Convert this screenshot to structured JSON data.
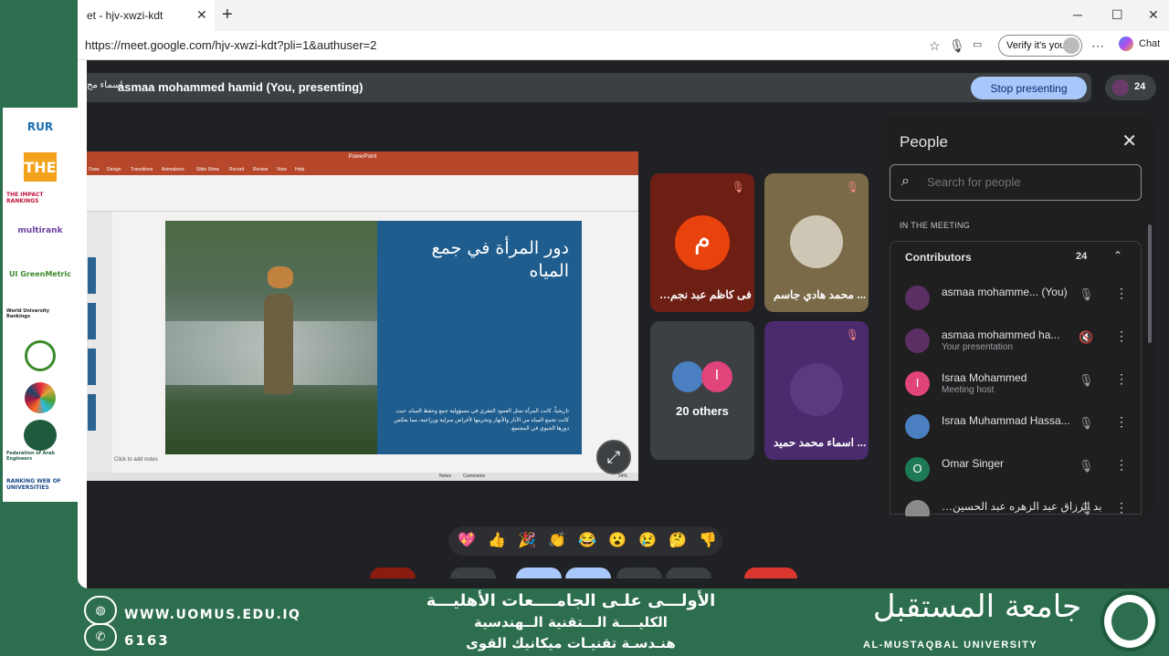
{
  "browser": {
    "tab_title": "et - hjv-xwzi-kdt",
    "tab_close": "✕",
    "new_tab": "+",
    "url": "https://meet.google.com/hjv-xwzi-kdt?pli=1&authuser=2",
    "verify_label": "Verify it's you",
    "chat_label": "Chat",
    "window_controls": {
      "minimize": "─",
      "maximize": "☐",
      "close": "✕"
    }
  },
  "meet": {
    "presenting_cut": "اسماء مح",
    "presenting_label": "asmaa mohammed hamid (You, presenting)",
    "stop_label": "Stop presenting",
    "participant_count": "24",
    "expand_icon": "⤢"
  },
  "slide": {
    "title": "دور المرأة في جمع المياه",
    "body": "تاريخياً، كانت المرأة تمثل العمود الفقري في مسؤولية جمع وحفظ المياه. حيث كانت تجمع المياه من الآبار والأنهار وتخزينها لأغراض منزلية وزراعية، مما يعكس دورها الحيوي في المجتمع.",
    "notes_placeholder": "Click to add notes",
    "ribbon_tabs": [
      "Draw",
      "Design",
      "Transitions",
      "Animations",
      "Slide Show",
      "Record",
      "Review",
      "View",
      "Help"
    ],
    "status_notes": "Notes",
    "status_comments": "Comments",
    "status_zoom": "54%"
  },
  "tiles": [
    {
      "name": "…فى كاظم عبد نجم",
      "initial": "م",
      "color": "#e8430c"
    },
    {
      "name": "محمد هادي جاسم ...",
      "color": "#7a6a48"
    },
    {
      "name": "20 others",
      "initial": "I",
      "color": "#e0447a"
    },
    {
      "name": "اسماء محمد حميد ...",
      "color": "#4b2a6e"
    }
  ],
  "people": {
    "title": "People",
    "search_placeholder": "Search for people",
    "section_label": "IN THE MEETING",
    "group_label": "Contributors",
    "group_count": "24",
    "rows": [
      {
        "name": "asmaa mohamme...  (You)",
        "sub": "",
        "initial": "",
        "color": "#5b2f64"
      },
      {
        "name": "asmaa mohammed ha...",
        "sub": "Your presentation",
        "initial": "",
        "color": "#5b2f64"
      },
      {
        "name": "Israa Mohammed",
        "sub": "Meeting host",
        "initial": "I",
        "color": "#e0447a"
      },
      {
        "name": "Israa Muhammad Hassa...",
        "sub": "",
        "initial": "",
        "color": "#4a7fc1"
      },
      {
        "name": "Omar Singer",
        "sub": "",
        "initial": "O",
        "color": "#1e7a55"
      },
      {
        "name": "…بد الرزاق عبد الزهره عبد الحسين",
        "sub": "",
        "initial": "",
        "color": "#8a8a8a"
      }
    ]
  },
  "reactions": [
    "💖",
    "👍",
    "🎉",
    "👏",
    "😂",
    "😮",
    "😢",
    "🤔",
    "👎"
  ],
  "footer": {
    "website": "WWW.UOMUS.EDU.IQ",
    "phone": "6163",
    "line1": "الأولـــى علـى الجامــــعات الأهليـــة",
    "line2": "الكليــــة الـــتقنية الــهندسية",
    "line3": "هنـدسـة تقنيـات ميكانيك القوى",
    "uni_ar": "جامعة المستقبل",
    "uni_en": "AL-MUSTAQBAL  UNIVERSITY"
  },
  "rankings": {
    "logos": [
      "RUR",
      "THE",
      "THE IMPACT RANKINGS",
      "multirank",
      "UI GreenMetric",
      "World University Rankings",
      "Federation of Arab Engineers",
      "RANKING WEB OF UNIVERSITIES"
    ]
  },
  "colors": {
    "meet_bg": "#202124",
    "accent": "#a8c7fa",
    "ppt_red": "#b7472a",
    "slide_blue": "#1e5d8e",
    "footer_green": "#2d6e4e"
  }
}
